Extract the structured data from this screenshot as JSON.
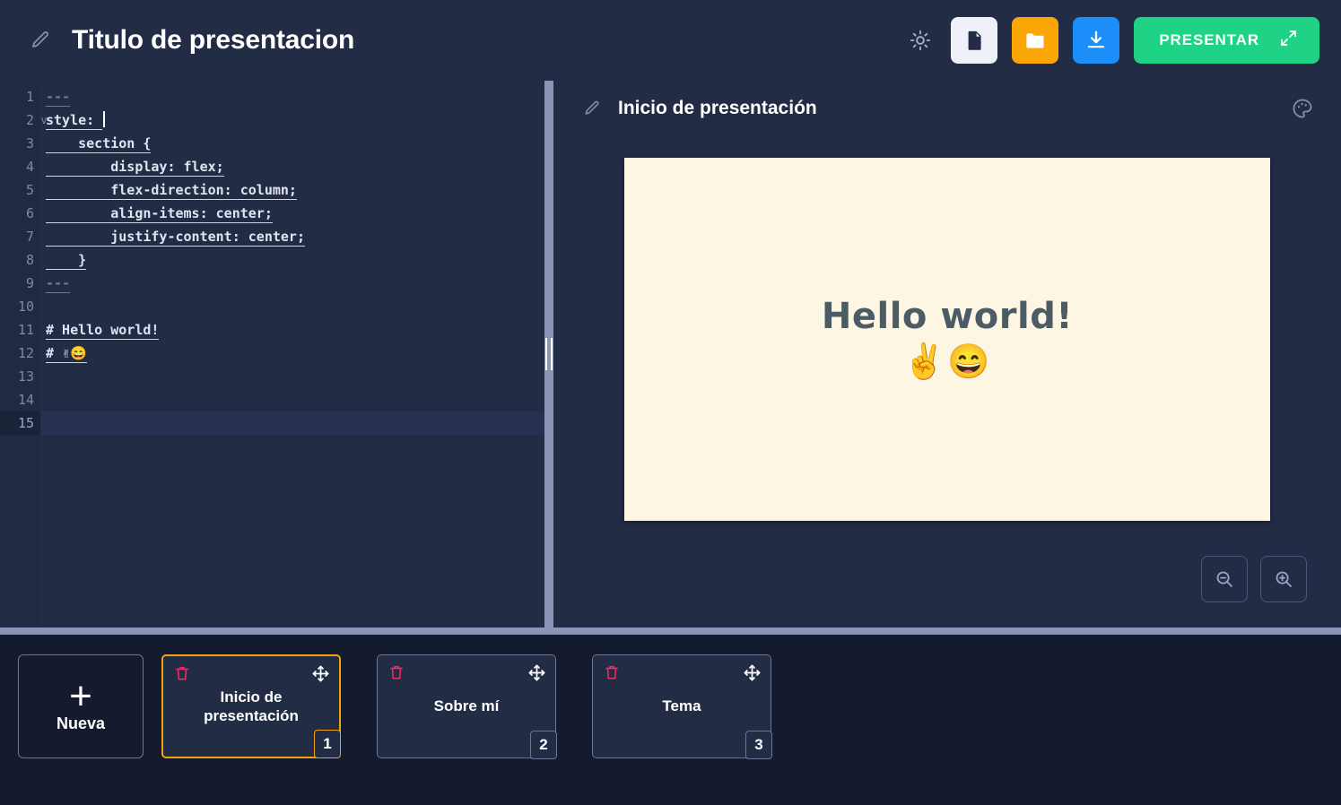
{
  "topbar": {
    "edit_icon": "pencil-icon",
    "title": "Titulo de presentacion",
    "theme_toggle_icon": "sun-icon",
    "new_file_label": "file-icon",
    "open_folder_label": "folder-icon",
    "download_label": "download-icon",
    "present_label": "PRESENTAR",
    "present_expand_icon": "expand-icon"
  },
  "editor": {
    "lines": [
      {
        "n": "1",
        "text": "---",
        "dim": true,
        "fold": "",
        "active": false
      },
      {
        "n": "2",
        "text": "style: ",
        "dim": false,
        "fold": "v",
        "active": false,
        "caret": true
      },
      {
        "n": "3",
        "text": "    section {",
        "dim": false,
        "fold": "",
        "active": false
      },
      {
        "n": "4",
        "text": "        display: flex;",
        "dim": false,
        "fold": "",
        "active": false
      },
      {
        "n": "5",
        "text": "        flex-direction: column;",
        "dim": false,
        "fold": "",
        "active": false
      },
      {
        "n": "6",
        "text": "        align-items: center;",
        "dim": false,
        "fold": "",
        "active": false
      },
      {
        "n": "7",
        "text": "        justify-content: center;",
        "dim": false,
        "fold": "",
        "active": false
      },
      {
        "n": "8",
        "text": "    }",
        "dim": false,
        "fold": "",
        "active": false
      },
      {
        "n": "9",
        "text": "---",
        "dim": true,
        "fold": "",
        "active": false
      },
      {
        "n": "10",
        "text": "",
        "dim": false,
        "fold": "",
        "active": false
      },
      {
        "n": "11",
        "text": "# Hello world!",
        "dim": false,
        "fold": "",
        "active": false
      },
      {
        "n": "12",
        "text": "# ✌😄",
        "dim": false,
        "fold": "",
        "active": false
      },
      {
        "n": "13",
        "text": "",
        "dim": false,
        "fold": "",
        "active": false
      },
      {
        "n": "14",
        "text": "",
        "dim": false,
        "fold": "",
        "active": false
      },
      {
        "n": "15",
        "text": "",
        "dim": false,
        "fold": "",
        "active": true
      }
    ]
  },
  "preview": {
    "edit_icon": "pencil-icon",
    "title": "Inicio de presentación",
    "palette_icon": "palette-icon",
    "slide": {
      "heading": "Hello world!",
      "emoji": "✌️😄",
      "background_color": "#fdf6e3",
      "text_color": "#4c5c66"
    },
    "zoom_out_label": "zoom-out-icon",
    "zoom_in_label": "zoom-in-icon"
  },
  "thumbnails": {
    "new_slide": {
      "plus": "+",
      "label": "Nueva"
    },
    "items": [
      {
        "label": "Inicio de presentación",
        "number": "1",
        "selected": true
      },
      {
        "label": "Sobre mí",
        "number": "2",
        "selected": false
      },
      {
        "label": "Tema",
        "number": "3",
        "selected": false
      }
    ]
  },
  "colors": {
    "background": "#222c45",
    "thumbstrip_background": "#151b2e",
    "accent_orange": "#f2a30f",
    "accent_green": "#1ed286",
    "accent_blue": "#1c8ef9",
    "accent_pink": "#ed2d63",
    "splitter": "#8b95b5"
  }
}
